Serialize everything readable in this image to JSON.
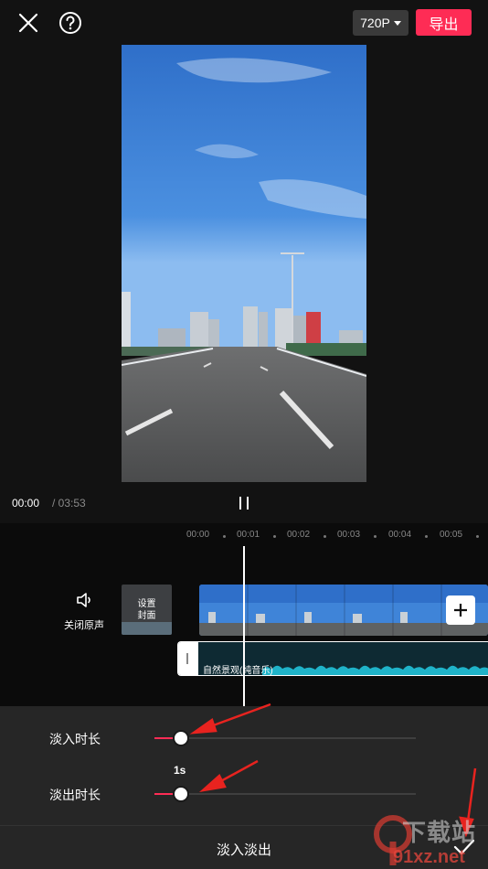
{
  "topbar": {
    "close_icon": "close-icon",
    "help_icon": "help-icon",
    "resolution_label": "720P",
    "export_label": "导出"
  },
  "colors": {
    "accent": "#fe2c55",
    "background": "#121212",
    "panel": "#262626",
    "waveform": "#1fb3c9"
  },
  "playback": {
    "current_time": "00:00",
    "total_time": "/ 03:53",
    "pause_icon": "pause-icon"
  },
  "timeline": {
    "ticks": [
      "00:00",
      "00:01",
      "00:02",
      "00:03",
      "00:04",
      "00:05"
    ],
    "mute_label": "关闭原声",
    "mute_icon": "speaker-icon",
    "cover_label_line1": "设置",
    "cover_label_line2": "封面",
    "add_icon": "plus-icon",
    "audio_label": "自然景观(纯音乐)"
  },
  "panel": {
    "fade_in_label": "淡入时长",
    "fade_out_label": "淡出时长",
    "fade_out_value": "1s",
    "fade_in_level": 0.1,
    "fade_out_level": 0.1,
    "title": "淡入淡出",
    "confirm_icon": "checkmark-icon"
  },
  "watermark": {
    "top": "下载站",
    "bottom": "91xz.net"
  }
}
